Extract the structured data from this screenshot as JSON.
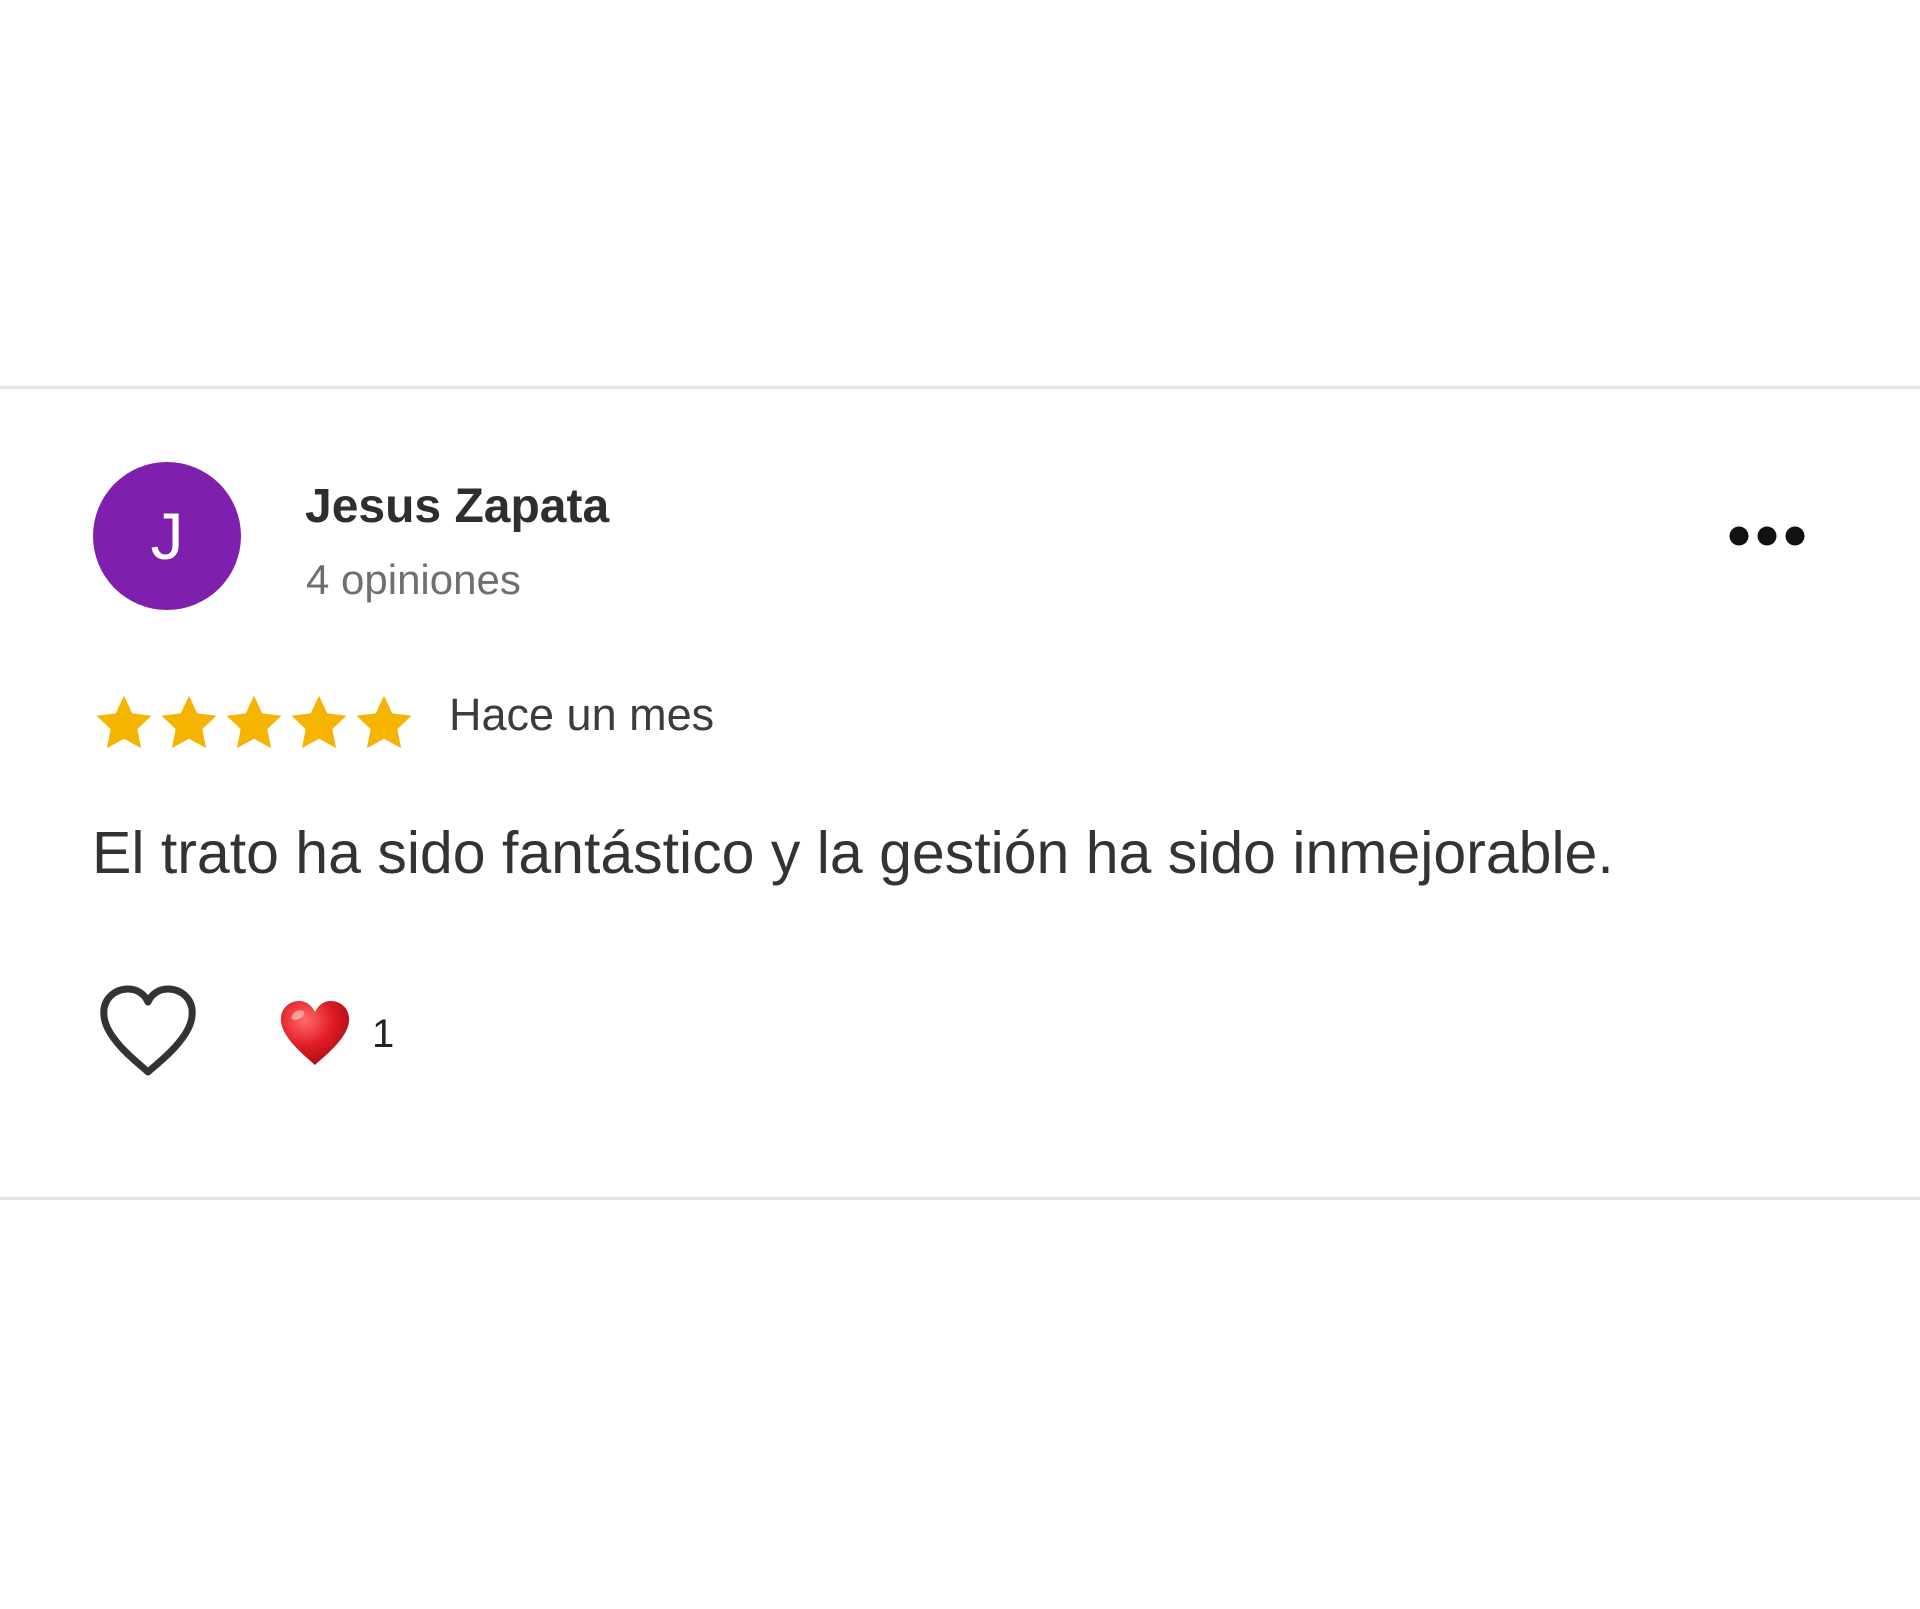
{
  "review": {
    "avatar_initial": "J",
    "avatar_color": "#7e1fad",
    "reviewer_name": "Jesus Zapata",
    "review_count_label": "4 opiniones",
    "rating": 5,
    "rating_max": 5,
    "star_color": "#f4b400",
    "date_label": "Hace un mes",
    "text": "El trato ha sido fantástico y la gestión ha sido inmejorable.",
    "reaction_count": "1",
    "icons": {
      "more": "more-options-icon",
      "like": "heart-outline-icon",
      "reaction": "red-heart-icon"
    }
  }
}
